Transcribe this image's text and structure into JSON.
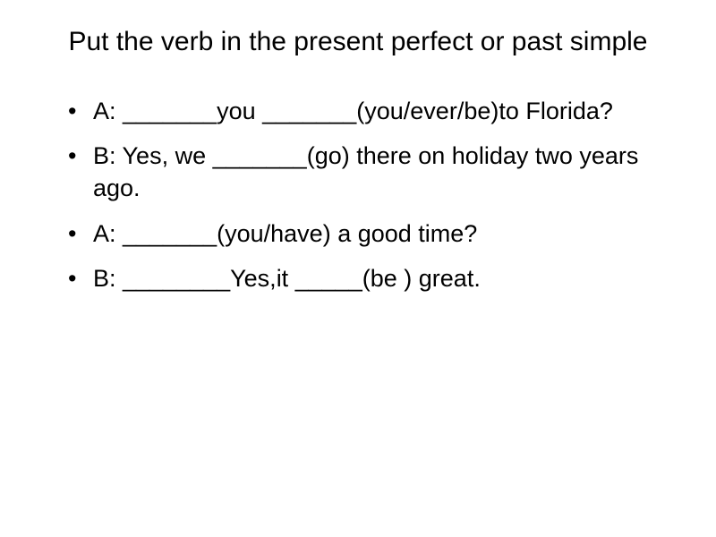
{
  "title": "Put the verb in the present perfect or past simple",
  "items": [
    "A: _______you _______(you/ever/be)to Florida?",
    "B: Yes, we _______(go) there on holiday two years ago.",
    "A: _______(you/have) a good time?",
    "B: ________Yes,it _____(be ) great."
  ],
  "bullet": "•"
}
